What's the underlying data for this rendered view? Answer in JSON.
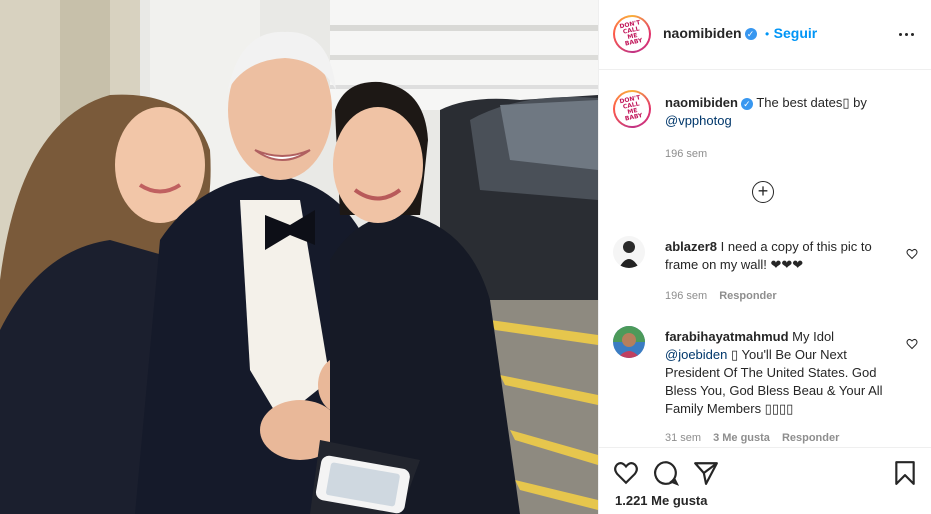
{
  "header": {
    "username": "naomibiden",
    "follow_label": "Seguir",
    "separator": "•",
    "logo_text": "DON'T CALL ME BABY"
  },
  "caption": {
    "username": "naomibiden",
    "text": "The best dates▯ by",
    "mention": "@vpphotog",
    "time": "196 sem"
  },
  "comments": [
    {
      "username": "ablazer8",
      "text": "I need a copy of this pic to frame on my wall! ❤❤❤",
      "time": "196 sem",
      "likes": "",
      "reply_label": "Responder"
    },
    {
      "username": "farabihayatmahmud",
      "text_before": "My Idol",
      "mention": "@joebiden",
      "text_after": "▯ You'll Be Our Next President Of The United States. God Bless You, God Bless Beau & Your All Family Members ▯▯▯▯",
      "time": "31 sem",
      "likes": "3 Me gusta",
      "reply_label": "Responder"
    }
  ],
  "footer": {
    "likes_count": "1.221 Me gusta"
  },
  "icons": {
    "verified": "verified-badge-icon",
    "more": "more-options-icon",
    "load_more": "plus-circle-icon",
    "like": "heart-icon",
    "comment": "comment-icon",
    "share": "paper-plane-icon",
    "save": "bookmark-icon"
  },
  "colors": {
    "accent": "#0095f6",
    "verified": "#3897f0",
    "meta": "#8e8e8e",
    "mention": "#00376b"
  }
}
